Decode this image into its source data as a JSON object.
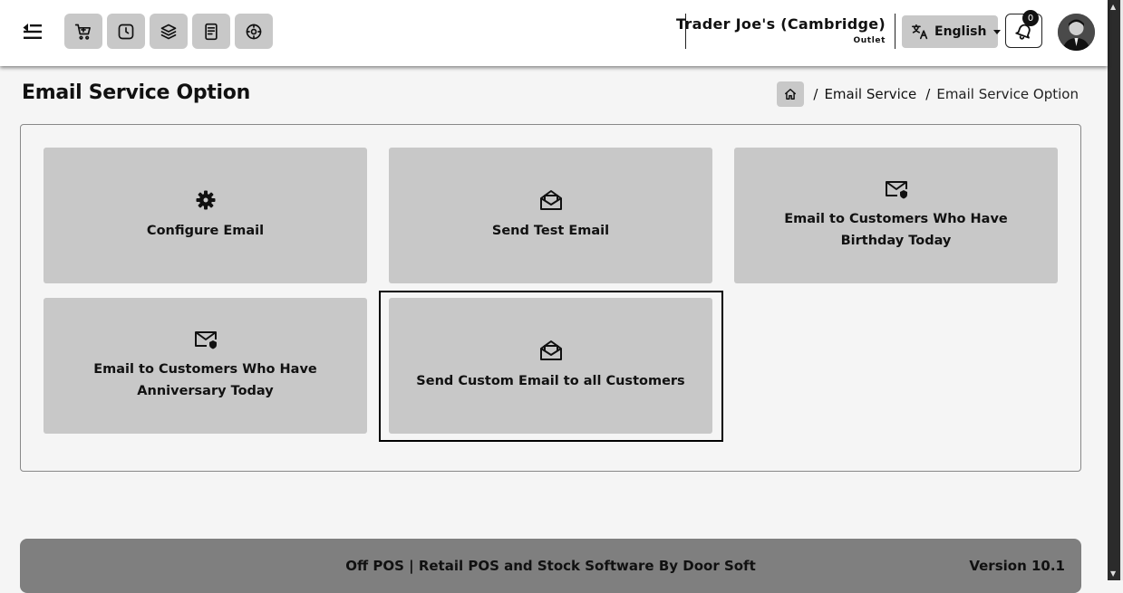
{
  "header": {
    "outlet_name": "Trader Joe's (Cambridge)",
    "outlet_label": "Outlet",
    "language": "English",
    "notification_count": "0",
    "quick_buttons": [
      "cart-icon",
      "clock-icon",
      "stack-icon",
      "receipt-icon",
      "dashboard-icon"
    ]
  },
  "page": {
    "title": "Email Service Option"
  },
  "breadcrumb": {
    "items": [
      "Email Service",
      "Email Service Option"
    ],
    "separator": "/"
  },
  "cards": [
    {
      "label": "Configure Email",
      "icon": "gear-icon"
    },
    {
      "label": "Send Test Email",
      "icon": "open-envelope-icon"
    },
    {
      "label": "Email to Customers Who Have Birthday Today",
      "icon": "envelope-badge-icon"
    },
    {
      "label": "Email to Customers Who Have Anniversary Today",
      "icon": "envelope-badge-icon"
    },
    {
      "label": "Send Custom Email to all Customers",
      "icon": "open-envelope-icon",
      "selected": true
    }
  ],
  "footer": {
    "text": "Off POS | Retail POS and Stock Software By Door Soft",
    "version": "Version 10.1"
  },
  "colors": {
    "card_bg": "#c8c8c8",
    "footer_bg": "#7f7f7f",
    "page_bg": "#f5f5f5"
  }
}
